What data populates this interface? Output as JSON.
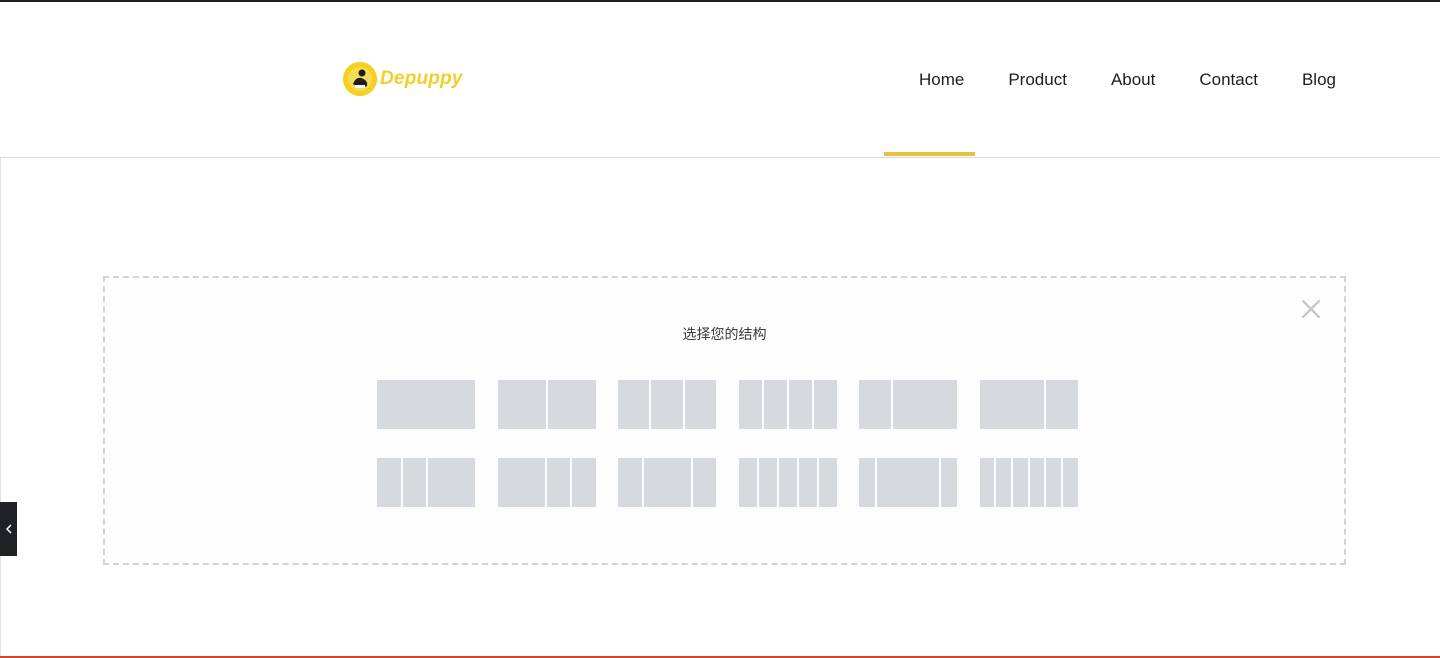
{
  "site": {
    "logo_text": "Depuppy",
    "colors": {
      "brand": "#f0cf2c",
      "accent": "#e7c13a",
      "placeholder": "#d6d9dd"
    }
  },
  "nav": {
    "items": [
      {
        "label": "Home",
        "active": true
      },
      {
        "label": "Product"
      },
      {
        "label": "About"
      },
      {
        "label": "Contact"
      },
      {
        "label": "Blog"
      }
    ]
  },
  "structure_picker": {
    "title": "选择您的结构",
    "close_icon": "close-icon",
    "layouts": [
      [
        [
          1
        ],
        [
          1,
          1
        ],
        [
          1,
          1,
          1
        ],
        [
          1,
          1,
          1,
          1
        ],
        [
          1,
          2
        ],
        [
          2,
          1
        ]
      ],
      [
        [
          1,
          1,
          2
        ],
        [
          2,
          1,
          1
        ],
        [
          1,
          2,
          1
        ],
        [
          1,
          1,
          1,
          1,
          1
        ],
        [
          1,
          4,
          1
        ],
        [
          1,
          1,
          1,
          1,
          1,
          1
        ]
      ]
    ]
  },
  "sidebar_toggle": {
    "icon": "chevron-left-icon"
  }
}
